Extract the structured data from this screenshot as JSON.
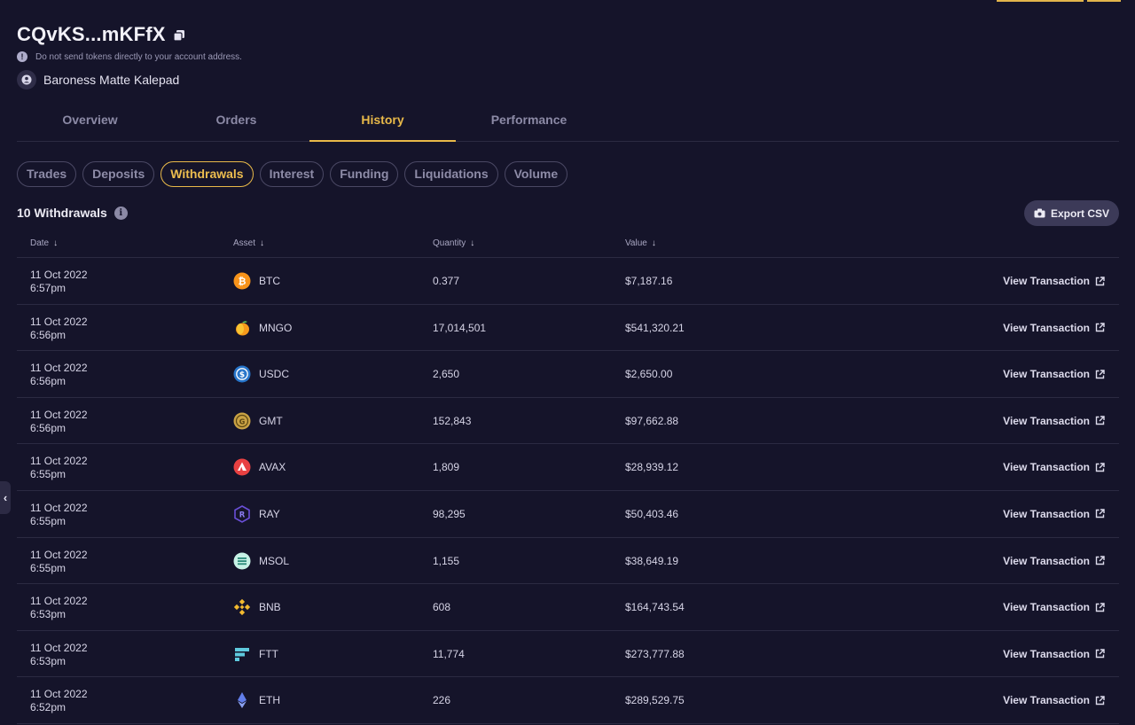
{
  "account": {
    "title": "CQvKS...mKFfX",
    "warning": "Do not send tokens directly to your account address.",
    "owner": "Baroness Matte Kalepad"
  },
  "tabs": [
    "Overview",
    "Orders",
    "History",
    "Performance"
  ],
  "active_tab": "History",
  "history_filters": [
    "Trades",
    "Deposits",
    "Withdrawals",
    "Interest",
    "Funding",
    "Liquidations",
    "Volume"
  ],
  "active_filter": "Withdrawals",
  "summary": {
    "count_label": "10 Withdrawals",
    "export_label": "Export CSV"
  },
  "table": {
    "columns": [
      "Date",
      "Asset",
      "Quantity",
      "Value"
    ],
    "view_label": "View Transaction",
    "rows": [
      {
        "date": "11 Oct 2022",
        "time": "6:57pm",
        "asset": "BTC",
        "icon": "btc-icon",
        "quantity": "0.377",
        "value": "$7,187.16"
      },
      {
        "date": "11 Oct 2022",
        "time": "6:56pm",
        "asset": "MNGO",
        "icon": "mngo-icon",
        "quantity": "17,014,501",
        "value": "$541,320.21"
      },
      {
        "date": "11 Oct 2022",
        "time": "6:56pm",
        "asset": "USDC",
        "icon": "usdc-icon",
        "quantity": "2,650",
        "value": "$2,650.00"
      },
      {
        "date": "11 Oct 2022",
        "time": "6:56pm",
        "asset": "GMT",
        "icon": "gmt-icon",
        "quantity": "152,843",
        "value": "$97,662.88"
      },
      {
        "date": "11 Oct 2022",
        "time": "6:55pm",
        "asset": "AVAX",
        "icon": "avax-icon",
        "quantity": "1,809",
        "value": "$28,939.12"
      },
      {
        "date": "11 Oct 2022",
        "time": "6:55pm",
        "asset": "RAY",
        "icon": "ray-icon",
        "quantity": "98,295",
        "value": "$50,403.46"
      },
      {
        "date": "11 Oct 2022",
        "time": "6:55pm",
        "asset": "MSOL",
        "icon": "msol-icon",
        "quantity": "1,155",
        "value": "$38,649.19"
      },
      {
        "date": "11 Oct 2022",
        "time": "6:53pm",
        "asset": "BNB",
        "icon": "bnb-icon",
        "quantity": "608",
        "value": "$164,743.54"
      },
      {
        "date": "11 Oct 2022",
        "time": "6:53pm",
        "asset": "FTT",
        "icon": "ftt-icon",
        "quantity": "11,774",
        "value": "$273,777.88"
      },
      {
        "date": "11 Oct 2022",
        "time": "6:52pm",
        "asset": "ETH",
        "icon": "eth-icon",
        "quantity": "226",
        "value": "$289,529.75"
      }
    ]
  },
  "colors": {
    "background": "#15142a",
    "accent": "#e8b949",
    "divider": "#2b2a42"
  }
}
